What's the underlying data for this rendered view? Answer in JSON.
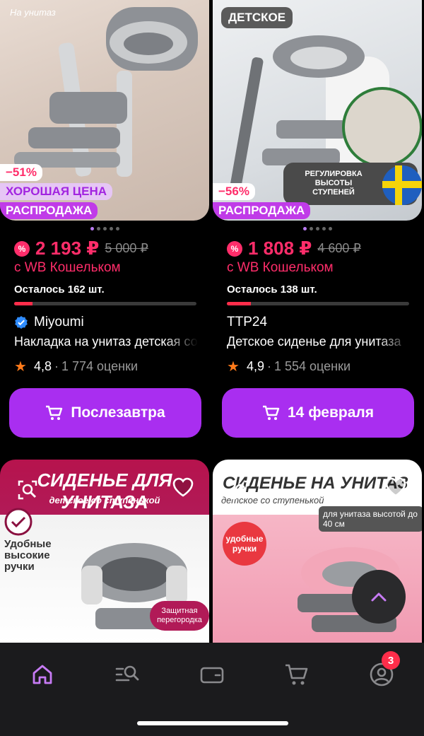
{
  "products": [
    {
      "image_caption": "На унитаз",
      "top_badge": "",
      "discount": "−51%",
      "tag_good_price": "ХОРОШАЯ ЦЕНА",
      "tag_sale": "РАСПРОДАЖА",
      "pct_icon": "%",
      "price": "2 193 ₽",
      "old_price": "5 000 ₽",
      "wallet_text": "с WB Кошельком",
      "stock_text": "Осталось 162 шт.",
      "stock_fill": 0.1,
      "brand": "Miyoumi",
      "verified": true,
      "title": "Накладка на унитаз детская со ступенькой",
      "rating": "4,8",
      "reviews": "1 774 оценки",
      "delivery": "Послезавтра"
    },
    {
      "image_caption": "",
      "top_badge": "ДЕТСКОЕ",
      "overlay_text": "РЕГУЛИРОВКА ВЫСОТЫ СТУПЕНЕЙ",
      "discount": "−56%",
      "tag_sale": "РАСПРОДАЖА",
      "pct_icon": "%",
      "price": "1 808 ₽",
      "old_price": "4 600 ₽",
      "wallet_text": "с WB Кошельком",
      "stock_text": "Осталось 138 шт.",
      "stock_fill": 0.13,
      "brand": "TTP24",
      "verified": false,
      "title": "Детское сиденье для унитаза",
      "rating": "4,9",
      "reviews": "1 554 оценки",
      "delivery": "14 февраля"
    }
  ],
  "lower_cards": [
    {
      "banner": "СИДЕНЬЕ ДЛЯ УНИТАЗА",
      "sub_banner": "детское со ступенькой",
      "feature": "Удобные высокие ручки",
      "badge_text": "Защитная перегородка"
    },
    {
      "banner": "СИДЕНЬЕ НА УНИТАЗ",
      "sub_banner": "детское со ступенькой",
      "feature": "удобные ручки",
      "badge_text": "для унитаза высотой до 40 см"
    }
  ],
  "nav": {
    "items": [
      "home-icon",
      "catalog-search-icon",
      "wallet-icon",
      "cart-icon",
      "profile-icon"
    ],
    "profile_badge": "3"
  },
  "colors": {
    "accent": "#a92ef0",
    "price": "#ff2d6a",
    "star": "#ff7a1a"
  }
}
